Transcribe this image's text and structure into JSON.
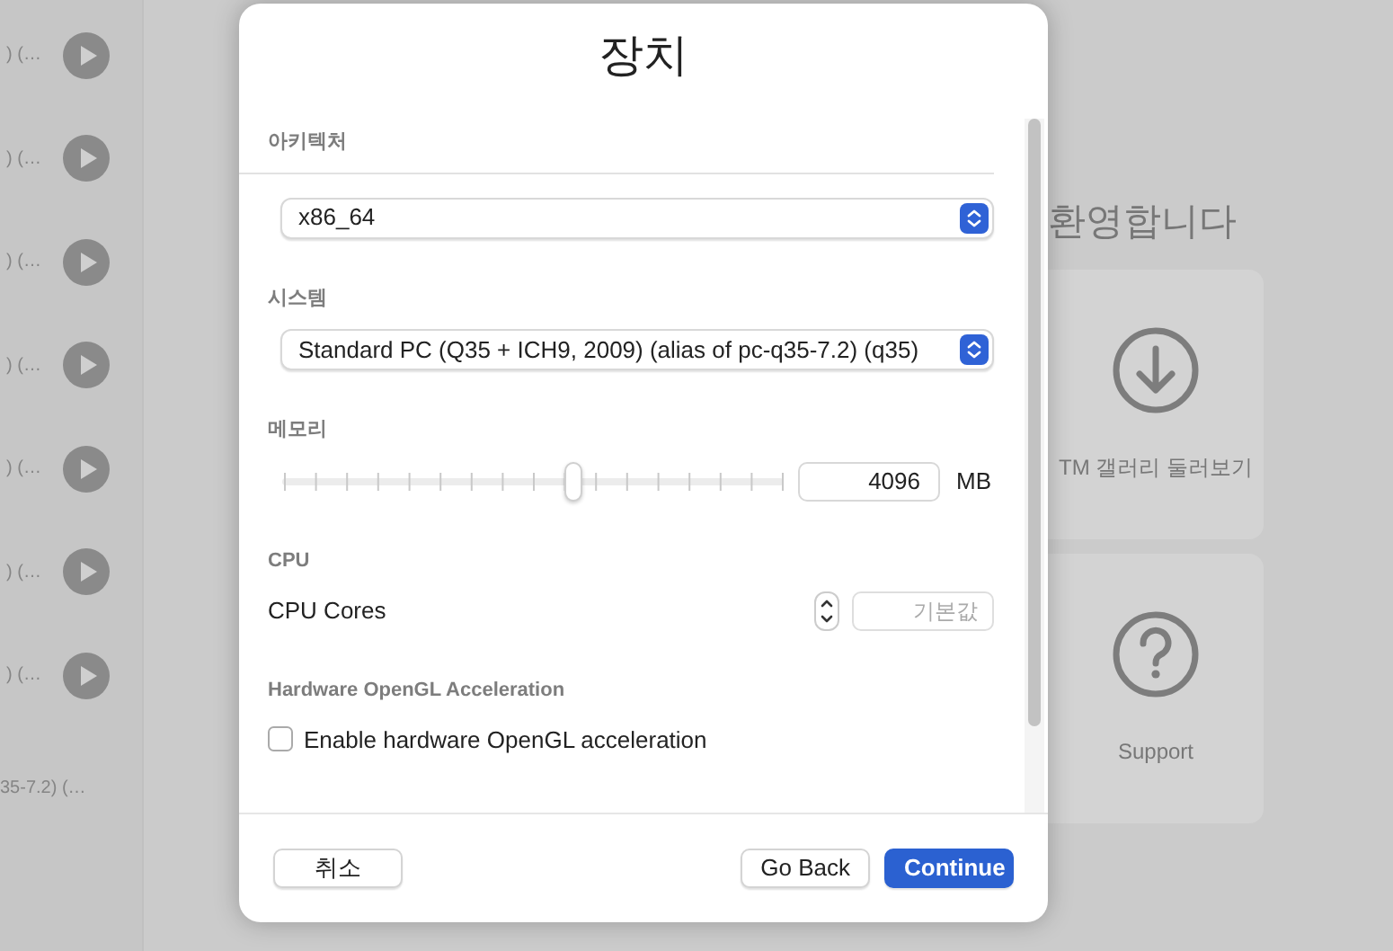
{
  "background": {
    "sidebar_rows": [
      {
        "text": ") (…",
        "kind": "play"
      },
      {
        "text": ") (…",
        "kind": "play"
      },
      {
        "text": ") (…",
        "kind": "play"
      },
      {
        "text": ") (…",
        "kind": "play"
      },
      {
        "text": ") (…",
        "kind": "play"
      },
      {
        "text": ") (…",
        "kind": "play"
      },
      {
        "text": ") (…",
        "kind": "play"
      },
      {
        "text": "35-7.2) (…",
        "kind": "plain"
      }
    ],
    "welcome_heading": "환영합니다",
    "cards": [
      {
        "label": "TM 갤러리 둘러보기",
        "kind": "download"
      },
      {
        "label": "Support",
        "kind": "help"
      }
    ]
  },
  "dialog": {
    "title": "장치",
    "sections": [
      {
        "kind": "select",
        "heading": "아키텍처",
        "value": "x86_64"
      },
      {
        "kind": "select",
        "heading": "시스템",
        "value": "Standard PC (Q35 + ICH9, 2009) (alias of pc-q35-7.2) (q35)"
      },
      {
        "kind": "slider",
        "heading": "메모리",
        "level": 0.58,
        "value": "4096",
        "unit": "MB"
      },
      {
        "kind": "stepper",
        "heading": "CPU",
        "label": "CPU Cores",
        "placeholder": "기본값"
      },
      {
        "kind": "checkbox",
        "heading": "Hardware OpenGL Acceleration",
        "label": "Enable hardware OpenGL acceleration",
        "checked": false
      }
    ],
    "buttons": [
      {
        "label": "취소",
        "kind": "cancel"
      },
      {
        "label": "Go Back",
        "kind": "secondary"
      },
      {
        "label": "Continue",
        "kind": "primary"
      }
    ]
  }
}
